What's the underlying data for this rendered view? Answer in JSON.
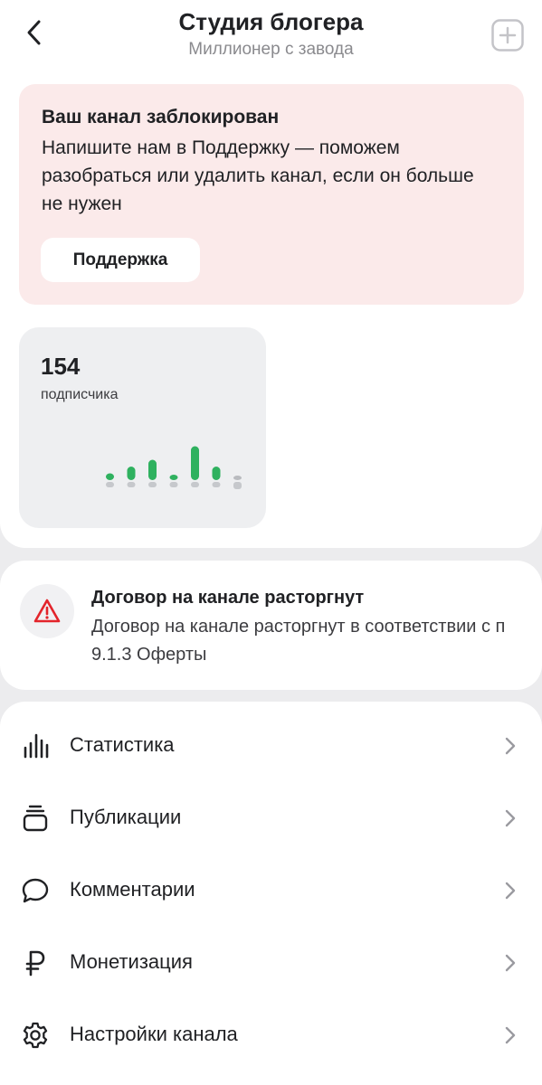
{
  "header": {
    "title": "Студия блогера",
    "subtitle": "Миллионер с завода"
  },
  "alert": {
    "title": "Ваш канал заблокирован",
    "text": "Напишите нам в Поддержку — поможем разобраться или удалить канал, если он больше не нужен",
    "button_label": "Поддержка",
    "background": "#fbeaea"
  },
  "subscribers": {
    "count": "154",
    "label": "подписчика",
    "trend_values": [
      1,
      2,
      3,
      0,
      5,
      2,
      -1
    ],
    "accent_color": "#2fb15f"
  },
  "notice": {
    "title": "Договор на канале расторгнут",
    "text": "Договор на канале расторгнут в соответствии с п 9.1.3 Оферты",
    "icon": "warning-triangle-icon",
    "icon_color": "#e3242b"
  },
  "menu": {
    "items": [
      {
        "label": "Статистика",
        "icon": "bar-chart-icon"
      },
      {
        "label": "Публикации",
        "icon": "publications-icon"
      },
      {
        "label": "Комментарии",
        "icon": "comment-icon"
      },
      {
        "label": "Монетизация",
        "icon": "ruble-icon"
      },
      {
        "label": "Настройки канала",
        "icon": "gear-icon"
      }
    ]
  }
}
